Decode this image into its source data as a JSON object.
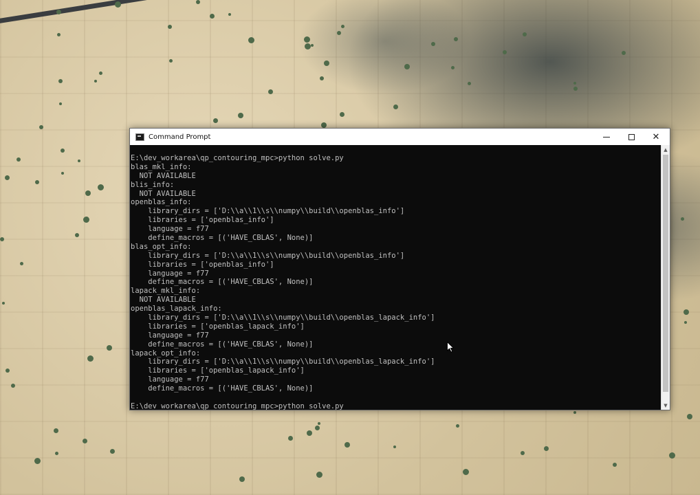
{
  "window": {
    "title": "Command Prompt",
    "minimize_glyph": "—",
    "close_glyph": "✕"
  },
  "console": {
    "lines": [
      "E:\\dev_workarea\\qp_contouring_mpc>python solve.py",
      "blas_mkl_info:",
      "  NOT AVAILABLE",
      "blis_info:",
      "  NOT AVAILABLE",
      "openblas_info:",
      "    library_dirs = ['D:\\\\a\\\\1\\\\s\\\\numpy\\\\build\\\\openblas_info']",
      "    libraries = ['openblas_info']",
      "    language = f77",
      "    define_macros = [('HAVE_CBLAS', None)]",
      "blas_opt_info:",
      "    library_dirs = ['D:\\\\a\\\\1\\\\s\\\\numpy\\\\build\\\\openblas_info']",
      "    libraries = ['openblas_info']",
      "    language = f77",
      "    define_macros = [('HAVE_CBLAS', None)]",
      "lapack_mkl_info:",
      "  NOT AVAILABLE",
      "openblas_lapack_info:",
      "    library_dirs = ['D:\\\\a\\\\1\\\\s\\\\numpy\\\\build\\\\openblas_lapack_info']",
      "    libraries = ['openblas_lapack_info']",
      "    language = f77",
      "    define_macros = [('HAVE_CBLAS', None)]",
      "lapack_opt_info:",
      "    library_dirs = ['D:\\\\a\\\\1\\\\s\\\\numpy\\\\build\\\\openblas_lapack_info']",
      "    libraries = ['openblas_lapack_info']",
      "    language = f77",
      "    define_macros = [('HAVE_CBLAS', None)]",
      "",
      "E:\\dev_workarea\\qp_contouring_mpc>python solve.py"
    ]
  },
  "scrollbar": {
    "up_glyph": "▲",
    "down_glyph": "▼",
    "position": 1.0
  },
  "colors": {
    "console_bg": "#0c0c0c",
    "console_text": "#c0c0c0",
    "title_bar_bg": "#ffffff"
  },
  "icons": {
    "app": "console-icon",
    "cursor": "mouse-pointer-icon"
  }
}
